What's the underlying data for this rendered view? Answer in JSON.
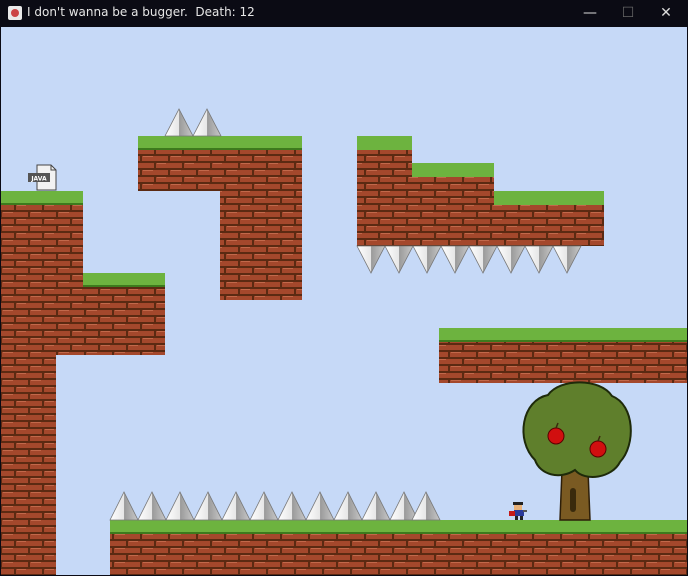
{
  "window": {
    "title": "I don't wanna be a bugger.  Death: 12",
    "minimize_glyph": "—",
    "maximize_glyph": "☐",
    "close_glyph": "✕"
  },
  "hud": {
    "death_count": 12
  },
  "save_point": {
    "label": "JAVA",
    "icon": "java-file-icon"
  },
  "colors": {
    "sky": "#c6d9f7",
    "grass": "#6db33f",
    "brick": "#a4482c",
    "mortar": "#5b2a12",
    "spike": "#dcdcdc",
    "tree_canopy": "#5f7f2c",
    "trunk": "#7a5a22",
    "apple": "#d10f0f"
  }
}
